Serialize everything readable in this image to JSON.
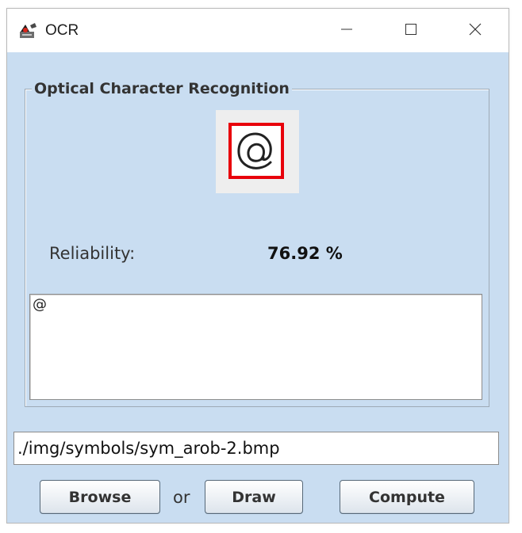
{
  "window": {
    "title": "OCR",
    "icon": "java-duke-icon",
    "controls": {
      "minimize": "minimize-icon",
      "maximize": "maximize-icon",
      "close": "close-icon"
    }
  },
  "group": {
    "title": "Optical Character Recognition"
  },
  "preview": {
    "symbol": "@",
    "selection_color": "#e8000b"
  },
  "reliability": {
    "label": "Reliability:",
    "value": "76.92 %"
  },
  "output": {
    "text": "@"
  },
  "file": {
    "path": "./img/symbols/sym_arob-2.bmp"
  },
  "buttons": {
    "browse": "Browse",
    "or": "or",
    "draw": "Draw",
    "compute": "Compute"
  },
  "colors": {
    "panel_background": "#c9ddf1",
    "selection_border": "#e8000b"
  }
}
